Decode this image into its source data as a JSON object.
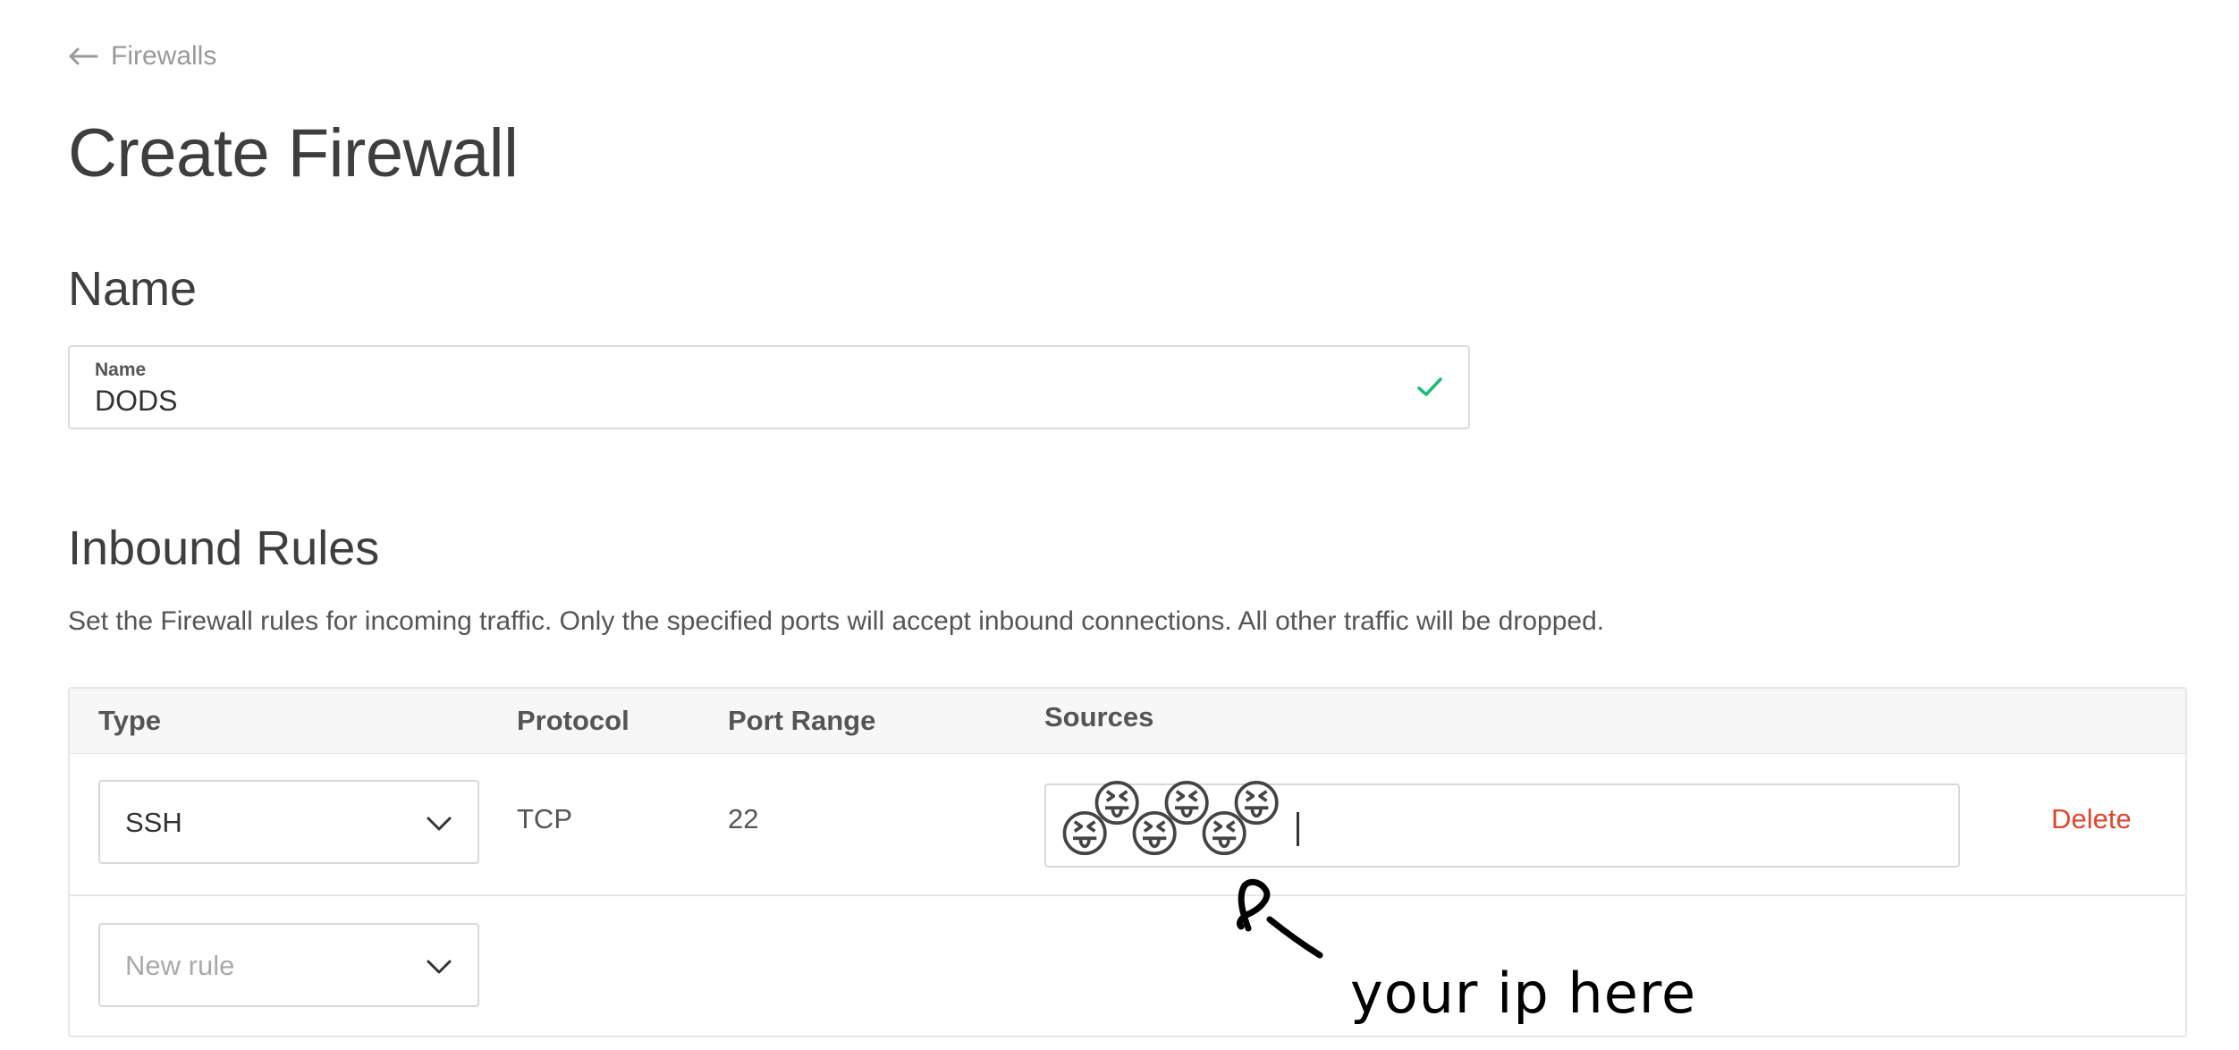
{
  "breadcrumb": {
    "back_label": "Firewalls",
    "icon": "arrow-left-icon"
  },
  "page": {
    "title": "Create Firewall"
  },
  "name_section": {
    "heading": "Name",
    "field_label": "Name",
    "field_value": "DODS",
    "valid_icon": "checkmark-icon",
    "valid_color": "#1bbc7a"
  },
  "inbound_rules": {
    "heading": "Inbound Rules",
    "description": "Set the Firewall rules for incoming traffic. Only the specified ports will accept inbound connections. All other traffic will be dropped.",
    "columns": [
      "Type",
      "Protocol",
      "Port Range",
      "Sources"
    ],
    "rows": [
      {
        "type": "SSH",
        "protocol": "TCP",
        "port_range": "22",
        "sources_value": "😝😝😝😝😝😝",
        "delete_label": "Delete"
      }
    ],
    "new_rule_placeholder": "New rule",
    "delete_color": "#e0452e"
  },
  "annotation": {
    "text": "your ip here"
  }
}
